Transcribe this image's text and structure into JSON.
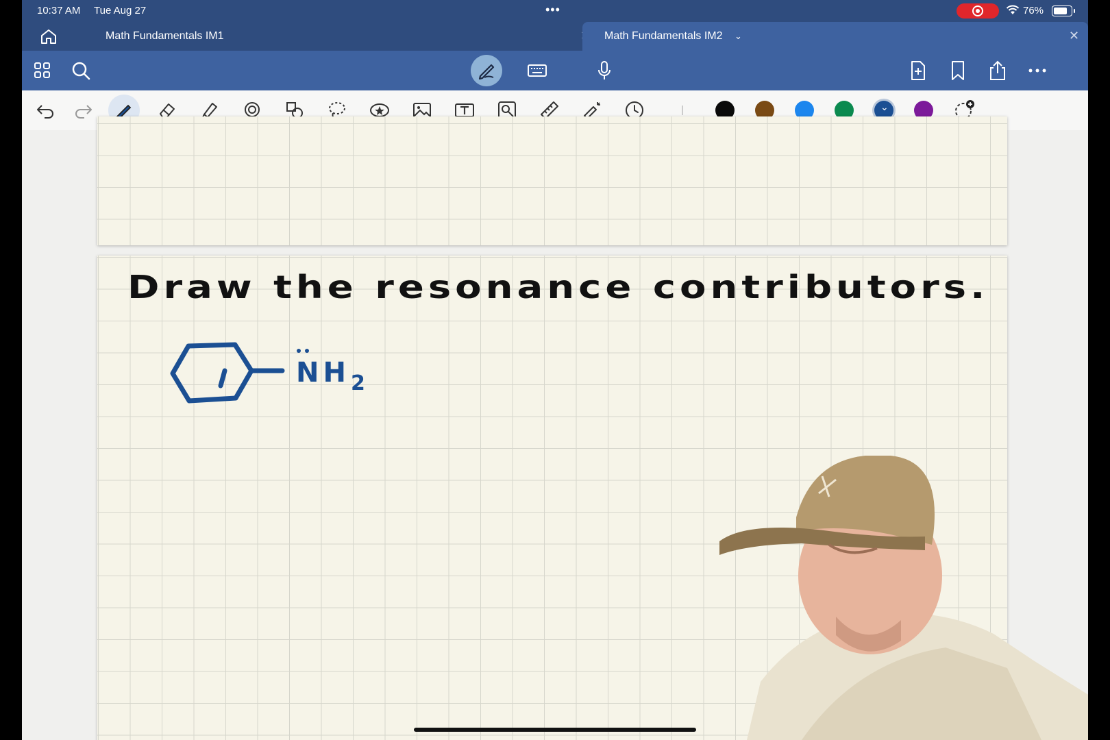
{
  "status": {
    "time": "10:37 AM",
    "date": "Tue Aug 27",
    "battery": "76%"
  },
  "tabs": [
    {
      "title": "Math Fundamentals IM1",
      "active": false
    },
    {
      "title": "Math Fundamentals IM2",
      "active": true
    }
  ],
  "toolbar": {
    "left": [
      "grid-icon",
      "search-icon"
    ],
    "center": [
      "pen-mode-icon",
      "keyboard-icon",
      "microphone-icon"
    ],
    "right": [
      "add-page-icon",
      "bookmark-icon",
      "share-icon",
      "more-icon"
    ]
  },
  "tools": [
    "undo-icon",
    "redo-icon",
    "pen-icon",
    "eraser-icon",
    "highlighter-icon",
    "shapes-icon",
    "elements-icon",
    "lasso-icon",
    "sticker-icon",
    "image-icon",
    "text-icon",
    "scan-icon",
    "ruler-icon",
    "laser-pointer-icon",
    "clock-icon"
  ],
  "colors": [
    {
      "name": "black",
      "hex": "#0a0a0a"
    },
    {
      "name": "brown",
      "hex": "#7a4a14"
    },
    {
      "name": "blue",
      "hex": "#1c86ee"
    },
    {
      "name": "green",
      "hex": "#0b8a4f"
    },
    {
      "name": "navy",
      "hex": "#1b4f93",
      "selected": true
    },
    {
      "name": "purple",
      "hex": "#7c1a9a"
    }
  ],
  "note": {
    "heading": "Draw the resonance contributors.",
    "molecule_label": "NH",
    "molecule_subscript": "2"
  }
}
